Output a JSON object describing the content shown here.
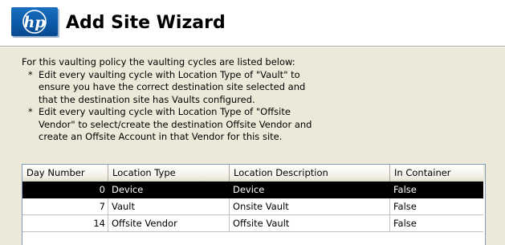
{
  "header": {
    "logo_text": "hp",
    "title": "Add Site Wizard"
  },
  "instructions": {
    "intro": "For this vaulting policy the vaulting cycles are listed below:",
    "bullets": [
      {
        "mark": "*",
        "text": "Edit every vaulting cycle with Location Type of \"Vault\" to\nensure you have the correct destination site selected and\nthat the destination site has Vaults configured."
      },
      {
        "mark": "*",
        "text": "Edit every vaulting cycle with Location Type of \"Offsite\nVendor\" to select/create the destination Offsite Vendor and\ncreate an Offsite Account in that Vendor for this site."
      }
    ]
  },
  "table": {
    "columns": [
      "Day Number",
      "Location Type",
      "Location Description",
      "In Container"
    ],
    "rows": [
      {
        "day": "0",
        "type": "Device",
        "description": "Device",
        "container": "False",
        "selected": true
      },
      {
        "day": "7",
        "type": "Vault",
        "description": "Onsite Vault",
        "container": "False",
        "selected": false
      },
      {
        "day": "14",
        "type": "Offsite Vendor",
        "description": "Offsite Vault",
        "container": "False",
        "selected": false
      }
    ]
  },
  "colors": {
    "window_bg": "#ece9d8",
    "header_bg": "#ffffff",
    "hp_blue": "#0b5aa8",
    "selection_bg": "#000000",
    "selection_fg": "#ffffff"
  }
}
